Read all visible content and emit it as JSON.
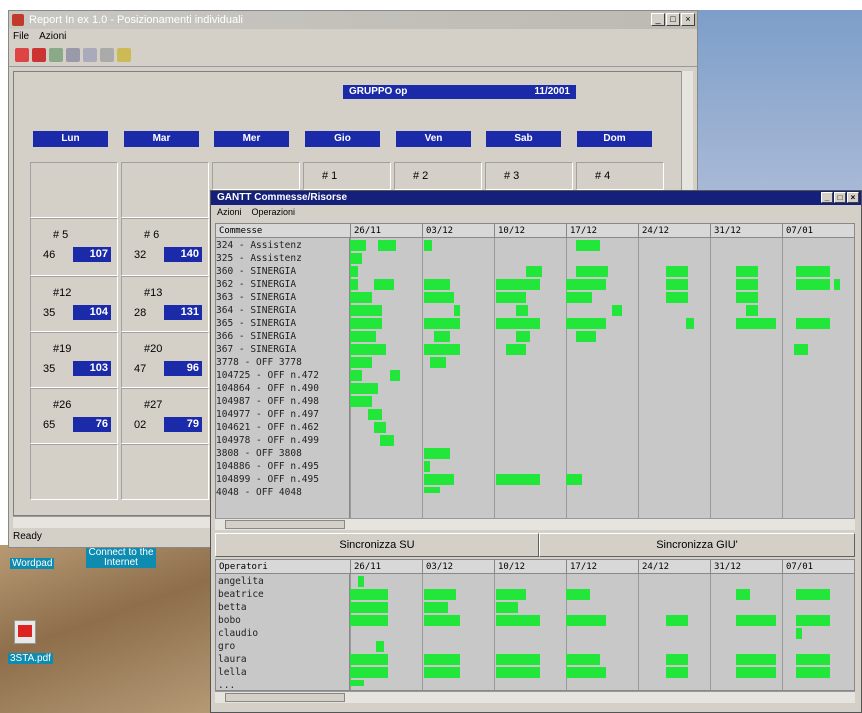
{
  "main": {
    "title": "Report In ex 1.0 - Posizionamenti individuali",
    "menu": [
      "File",
      "Azioni"
    ],
    "status": "Ready",
    "gruppo_label": "GRUPPO",
    "gruppo_value": "op",
    "gruppo_date": "11/2001",
    "days": [
      "Lun",
      "Mar",
      "Mer",
      "Gio",
      "Ven",
      "Sab",
      "Dom"
    ],
    "first_row_hashes": [
      "# 1",
      "# 2",
      "# 3",
      "# 4"
    ],
    "weeks": [
      {
        "label": "# 5",
        "a": "46",
        "b": "107",
        "label2": "# 6",
        "a2": "32",
        "b2": "140"
      },
      {
        "label": "#12",
        "a": "35",
        "b": "104",
        "label2": "#13",
        "a2": "28",
        "b2": "131"
      },
      {
        "label": "#19",
        "a": "35",
        "b": "103",
        "label2": "#20",
        "a2": "47",
        "b2": "96"
      },
      {
        "label": "#26",
        "a": "65",
        "b": "76",
        "label2": "#27",
        "a2": "02",
        "b2": "79"
      }
    ]
  },
  "desktop": {
    "icons": [
      "Wordpad",
      "Connect to the Internet",
      "3STA.pdf"
    ]
  },
  "gantt": {
    "title": "GANTT Commesse/Risorse",
    "menu": [
      "Azioni",
      "Operazioni"
    ],
    "top_header": "Commesse",
    "dates": [
      "26/11",
      "03/12",
      "10/12",
      "17/12",
      "24/12",
      "31/12",
      "07/01"
    ],
    "commesse": [
      "324 - Assistenz",
      "325 - Assistenz",
      "360 - SINERGIA",
      "362 - SINERGIA",
      "363 - SINERGIA",
      "364 - SINERGIA",
      "365 - SINERGIA",
      "366 - SINERGIA",
      "367 - SINERGIA",
      "3778 - OFF 3778",
      "104725 - OFF n.472",
      "104864 - OFF n.490",
      "104987 - OFF n.498",
      "104977 - OFF n.497",
      "104621 - OFF n.462",
      "104978 - OFF n.499",
      "3808 - OFF 3808",
      "104886 - OFF n.495",
      "104899 - OFF n.495",
      "4048 - OFF 4048"
    ],
    "sync_up": "Sincronizza SU",
    "sync_down": "Sincronizza GIU'",
    "bottom_header": "Operatori",
    "operatori": [
      "angelita",
      "beatrice",
      "betta",
      "bobo",
      "claudio",
      "gro",
      "laura",
      "lella",
      "..."
    ]
  }
}
